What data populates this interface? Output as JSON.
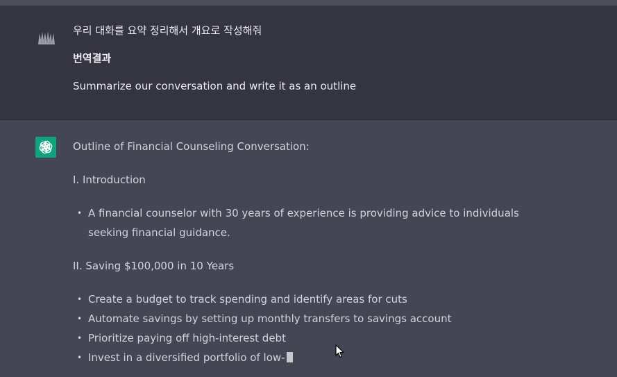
{
  "user": {
    "message_ko": "우리 대화를 요약 정리해서 개요로 작성해줘",
    "translation_label": "번역결과",
    "message_en": "Summarize our conversation and write it as an outline"
  },
  "assistant": {
    "heading": "Outline of Financial Counseling Conversation:",
    "sections": [
      {
        "title": "I. Introduction",
        "bullets": [
          "A financial counselor with 30 years of experience is providing advice to individuals",
          "seeking financial guidance."
        ]
      },
      {
        "title": "II. Saving $100,000 in 10 Years",
        "bullets": [
          "Create a budget to track spending and identify areas for cuts",
          "Automate savings by setting up monthly transfers to savings account",
          "Prioritize paying off high-interest debt",
          "Invest in a diversified portfolio of low-"
        ]
      }
    ]
  },
  "colors": {
    "user_bg": "#343541",
    "assistant_bg": "#444654",
    "gpt_avatar": "#10a37f",
    "text": "#ececf1"
  },
  "icons": {
    "user_avatar": "user-avatar-icon",
    "gpt_avatar": "openai-logo-icon",
    "mouse": "mouse-pointer-icon"
  }
}
